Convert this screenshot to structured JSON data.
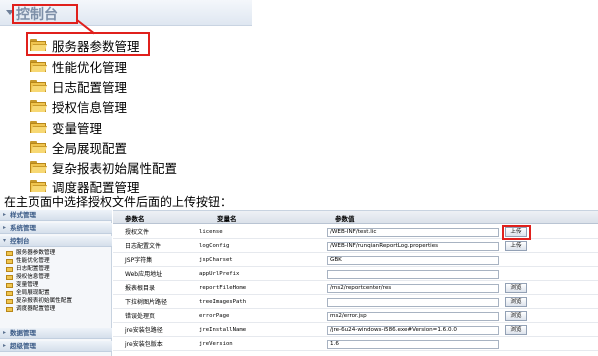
{
  "control_panel": {
    "title": "控制台",
    "items": [
      {
        "label": "服务器参数管理"
      },
      {
        "label": "性能优化管理"
      },
      {
        "label": "日志配置管理"
      },
      {
        "label": "授权信息管理"
      },
      {
        "label": "变量管理"
      },
      {
        "label": "全局展现配置"
      },
      {
        "label": "复杂报表初始属性配置"
      },
      {
        "label": "调度器配置管理"
      }
    ]
  },
  "caption": "在主页面中选择授权文件后面的上传按钮：",
  "sidebar": {
    "sections": {
      "style": "样式管理",
      "system": "系统管理",
      "console": "控制台",
      "data": "数据管理",
      "advanced": "超级管理"
    },
    "items": [
      {
        "label": "服务器参数管理"
      },
      {
        "label": "性能优化管理"
      },
      {
        "label": "日志配置管理"
      },
      {
        "label": "授权信息管理"
      },
      {
        "label": "变量管理"
      },
      {
        "label": "全局展现配置"
      },
      {
        "label": "复杂报表初始属性配置"
      },
      {
        "label": "调度器配置管理"
      }
    ]
  },
  "table": {
    "headers": {
      "name": "参数名",
      "variable": "变量名",
      "value": "参数值"
    },
    "rows": [
      {
        "name": "授权文件",
        "var": "license",
        "value": "/WEB-INF/test.lic",
        "button": "上传"
      },
      {
        "name": "日志配置文件",
        "var": "logConfig",
        "value": "/WEB-INF/runqianReportLog.properties",
        "button": "上传"
      },
      {
        "name": "JSP字符集",
        "var": "jspCharset",
        "value": "GBK",
        "button": ""
      },
      {
        "name": "Web应用地址",
        "var": "appUrlPrefix",
        "value": "",
        "button": ""
      },
      {
        "name": "报表根目录",
        "var": "reportFileHome",
        "value": "/ms2/reportcenter/res",
        "button": "浏览"
      },
      {
        "name": "下拉树图片路径",
        "var": "treeImagesPath",
        "value": "",
        "button": "浏览"
      },
      {
        "name": "错误处理页",
        "var": "errorPage",
        "value": "ms2/error.jsp",
        "button": "浏览"
      },
      {
        "name": "jre安装包路径",
        "var": "jreInstallName",
        "value": "/jre-6u24-windows-i586.exe#Version=1.6.0.0",
        "button": "浏览"
      },
      {
        "name": "jre安装包版本",
        "var": "jreVersion",
        "value": "1.6",
        "button": ""
      }
    ]
  },
  "colors": {
    "highlight": "#e0201c",
    "folder": "#f0c54f"
  }
}
